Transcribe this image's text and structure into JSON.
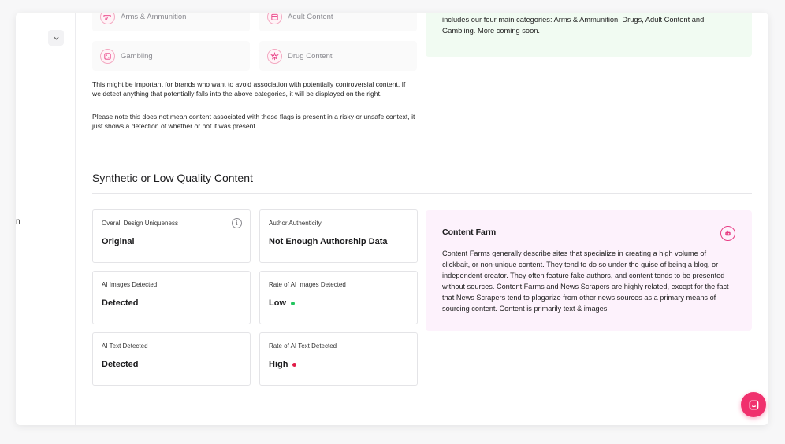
{
  "sidebar": {
    "partial_label": "n"
  },
  "categories": [
    {
      "label": "Arms & Ammunition",
      "icon": "gun-icon"
    },
    {
      "label": "Adult Content",
      "icon": "calendar-icon"
    },
    {
      "label": "Gambling",
      "icon": "dice-icon"
    },
    {
      "label": "Drug Content",
      "icon": "leaf-icon"
    }
  ],
  "brand_safety": {
    "paragraph1": "This might be important for brands who want to avoid association with potentially controversial content. If we detect anything that potentially falls into the above categories, it will be displayed on the right.",
    "paragraph2": "Please note this does not mean content associated with these flags is present in a risky or unsafe context, it just shows a detection of whether or not it was present.",
    "panel_text": "includes our four main categories: Arms & Ammunition, Drugs, Adult Content and Gambling. More coming soon."
  },
  "synthetic": {
    "title": "Synthetic or Low Quality Content",
    "cards": [
      {
        "label": "Overall Design Uniqueness",
        "value": "Original"
      },
      {
        "label": "Author Authenticity",
        "value": "Not Enough Authorship Data"
      },
      {
        "label": "AI Images Detected",
        "value": "Detected"
      },
      {
        "label": "Rate of AI Images Detected",
        "value": "Low",
        "status_color": "#22c55e"
      },
      {
        "label": "AI Text Detected",
        "value": "Detected"
      },
      {
        "label": "Rate of AI Text Detected",
        "value": "High",
        "status_color": "#e11d48"
      }
    ],
    "panel": {
      "title": "Content Farm",
      "body": "Content Farms generally describe sites that specialize in creating a high volume of clickbait, or non-unique content. They tend to do so under the guise of being a blog, or independent creator. They often feature fake authors, and content tends to be presented without sources. Content Farms and News Scrapers are highly related, except for the fact that News Scrapers tend to plagarize from other news sources as a primary means of sourcing content. Content is primarily text & images"
    }
  },
  "colors": {
    "accent": "#f0306d",
    "green_panel": "#f1fbf2",
    "pink_panel": "#fdf2fc"
  }
}
